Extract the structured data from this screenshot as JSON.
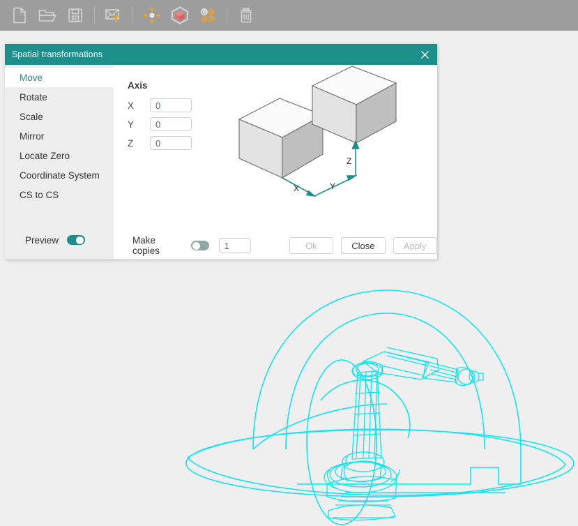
{
  "toolbar": {
    "buttons": [
      {
        "name": "new-file-icon",
        "label": "New"
      },
      {
        "name": "open-folder-icon",
        "label": "Open"
      },
      {
        "name": "save-icon",
        "label": "Save"
      },
      {
        "name": "import-export-icon",
        "label": "Import"
      },
      {
        "name": "move-arrows-icon",
        "label": "Move"
      },
      {
        "name": "cube-icon",
        "label": "Solid"
      },
      {
        "name": "points-targets-icon",
        "label": "Points"
      },
      {
        "name": "trash-icon",
        "label": "Delete"
      }
    ],
    "colors": {
      "background": "#9d9d9d",
      "icon_outline": "#d6d6d6",
      "accent_orange": "#e2a33c",
      "accent_red": "#e2706e",
      "separator": "#b4b4b4"
    }
  },
  "viewport": {
    "background": "#efefef",
    "model_name": "robot-arm-wireframe",
    "wire_color": "#11e5ef"
  },
  "dialog": {
    "title": "Spatial transformations",
    "close_icon": "close-icon",
    "titlebar_color": "#1d8f8a",
    "sidebar": {
      "items": [
        {
          "label": "Move",
          "active": true
        },
        {
          "label": "Rotate",
          "active": false
        },
        {
          "label": "Scale",
          "active": false
        },
        {
          "label": "Mirror",
          "active": false
        },
        {
          "label": "Locate Zero",
          "active": false
        },
        {
          "label": "Coordinate System",
          "active": false
        },
        {
          "label": "CS to CS",
          "active": false
        }
      ],
      "preview": {
        "label": "Preview",
        "state": "on"
      }
    },
    "main": {
      "heading": "Axis",
      "fields": [
        {
          "label": "X",
          "value": "0"
        },
        {
          "label": "Y",
          "value": "0"
        },
        {
          "label": "Z",
          "value": "0"
        }
      ],
      "figure": {
        "name": "move-cubes-diagram",
        "axis_labels": [
          "X",
          "Y",
          "Z"
        ],
        "arrow_color": "#1d8f8a"
      }
    },
    "footer": {
      "copies_label": "Make copies",
      "copies_toggle_state": "off",
      "copies_value": "1",
      "buttons": [
        {
          "label": "Ok",
          "state": "disabled"
        },
        {
          "label": "Close",
          "state": "enabled"
        },
        {
          "label": "Apply",
          "state": "disabled"
        }
      ]
    }
  }
}
